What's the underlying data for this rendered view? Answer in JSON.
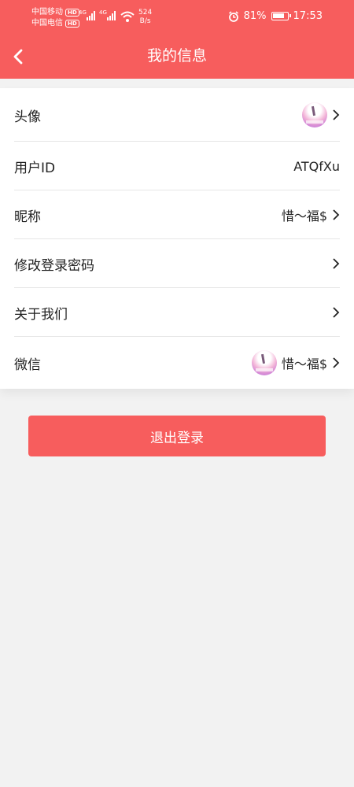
{
  "status_bar": {
    "carrier1": "中国移动",
    "carrier2": "中国电信",
    "hd": "HD",
    "net1": "4G",
    "net2": "4G",
    "speed_value": "524",
    "speed_unit": "B/s",
    "battery_percent_text": "81%",
    "battery_level": 0.81,
    "time": "17:53"
  },
  "header": {
    "title": "我的信息"
  },
  "rows": [
    {
      "label": "头像",
      "value": "",
      "has_avatar": true,
      "has_chevron": true
    },
    {
      "label": "用户ID",
      "value": "ATQfXu",
      "has_avatar": false,
      "has_chevron": false
    },
    {
      "label": "昵称",
      "value": "惜～福$",
      "has_avatar": false,
      "has_chevron": true
    },
    {
      "label": "修改登录密码",
      "value": "",
      "has_avatar": false,
      "has_chevron": true
    },
    {
      "label": "关于我们",
      "value": "",
      "has_avatar": false,
      "has_chevron": true
    },
    {
      "label": "微信",
      "value": "惜～福$",
      "has_avatar": true,
      "has_chevron": true
    }
  ],
  "logout_button": {
    "label": "退出登录"
  },
  "colors": {
    "brand": "#f75d5d",
    "background": "#f2f2f2"
  },
  "icons": {
    "back": "chevron-left-icon",
    "row_arrow": "chevron-right-icon",
    "alarm": "alarm-icon",
    "wifi": "wifi-icon",
    "battery": "battery-icon"
  }
}
